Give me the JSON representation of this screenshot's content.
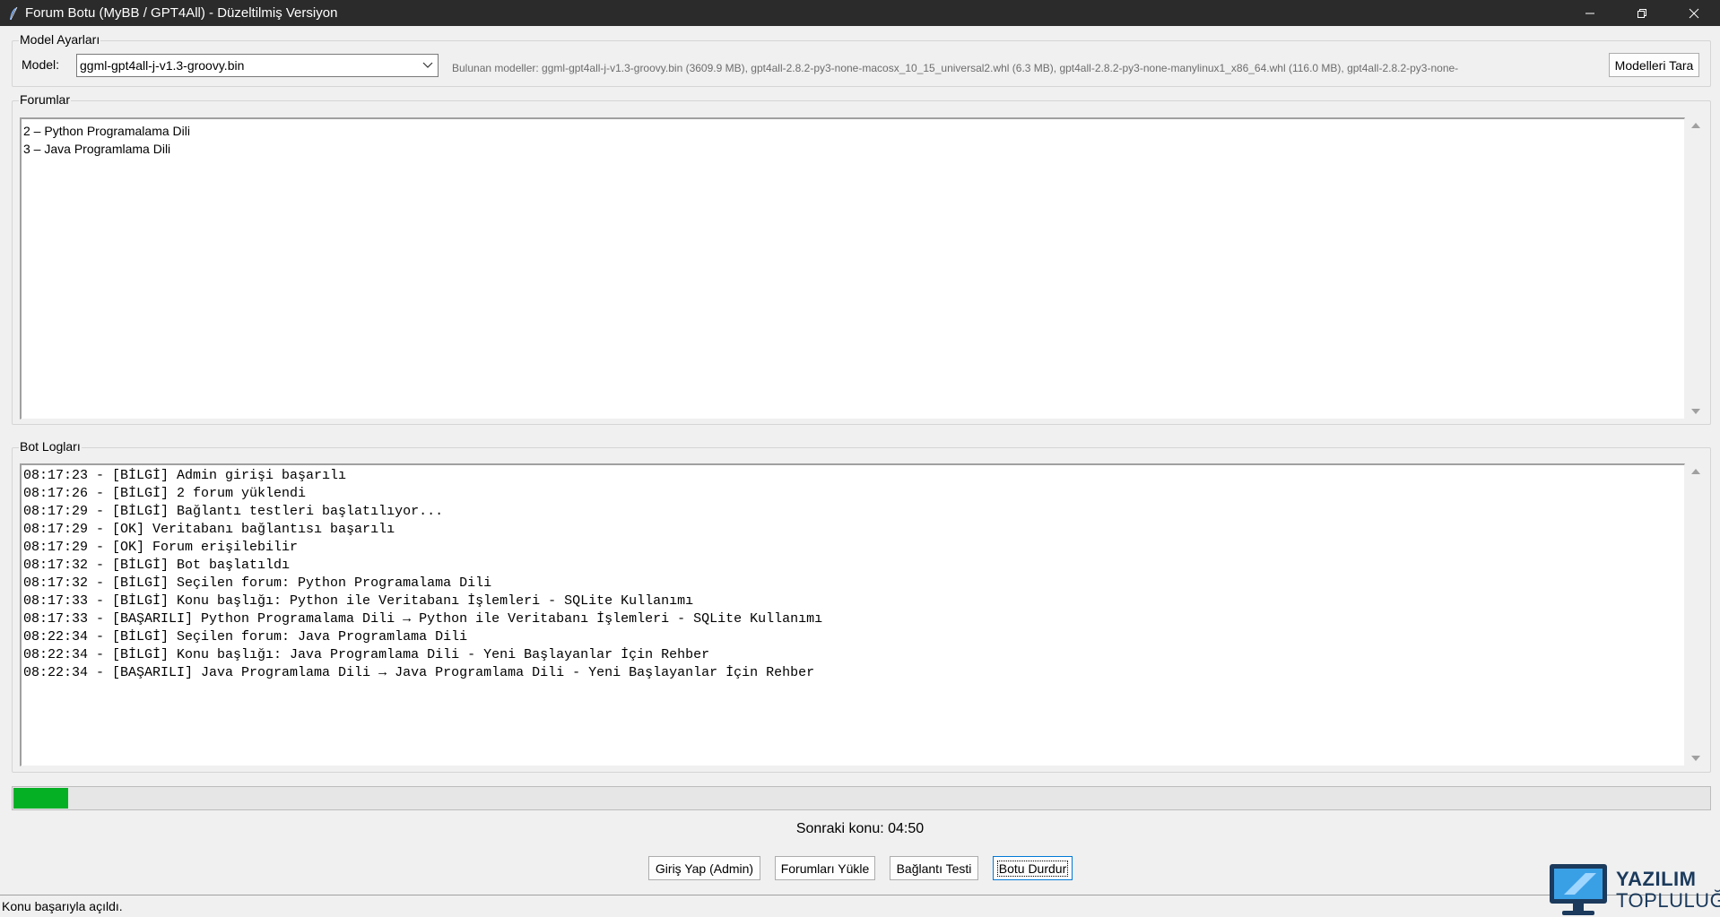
{
  "window": {
    "title": "Forum Botu (MyBB / GPT4All) - Düzeltilmiş Versiyon",
    "icon": "feather-icon"
  },
  "model_settings": {
    "group_label": "Model Ayarları",
    "model_label": "Model:",
    "selected_model": "ggml-gpt4all-j-v1.3-groovy.bin",
    "found_models_text": "Bulunan modeller: ggml-gpt4all-j-v1.3-groovy.bin (3609.9 MB), gpt4all-2.8.2-py3-none-macosx_10_15_universal2.whl (6.3 MB), gpt4all-2.8.2-py3-none-manylinux1_x86_64.whl (116.0 MB), gpt4all-2.8.2-py3-none-",
    "scan_button": "Modelleri Tara"
  },
  "forums": {
    "group_label": "Forumlar",
    "items": [
      "2 – Python Programalama Dili",
      "3 – Java Programlama Dili"
    ]
  },
  "logs": {
    "group_label": "Bot Logları",
    "lines": [
      "08:17:23 - [BİLGİ] Admin girişi başarılı",
      "08:17:26 - [BİLGİ] 2 forum yüklendi",
      "08:17:29 - [BİLGİ] Bağlantı testleri başlatılıyor...",
      "08:17:29 - [OK] Veritabanı bağlantısı başarılı",
      "08:17:29 - [OK] Forum erişilebilir",
      "08:17:32 - [BİLGİ] Bot başlatıldı",
      "08:17:32 - [BİLGİ] Seçilen forum: Python Programalama Dili",
      "08:17:33 - [BİLGİ] Konu başlığı: Python ile Veritabanı İşlemleri - SQLite Kullanımı",
      "08:17:33 - [BAŞARILI] Python Programalama Dili → Python ile Veritabanı İşlemleri - SQLite Kullanımı",
      "08:22:34 - [BİLGİ] Seçilen forum: Java Programlama Dili",
      "08:22:34 - [BİLGİ] Konu başlığı: Java Programlama Dili - Yeni Başlayanlar İçin Rehber",
      "08:22:34 - [BAŞARILI] Java Programlama Dili → Java Programlama Dili - Yeni Başlayanlar İçin Rehber"
    ]
  },
  "progress": {
    "fraction": 0.032,
    "color": "#06b025"
  },
  "next_topic_text": "Sonraki konu: 04:50",
  "actions": {
    "login": "Giriş Yap (Admin)",
    "load_forums": "Forumları Yükle",
    "connection_test": "Bağlantı Testi",
    "stop_bot": "Botu Durdur"
  },
  "status_bar": "Konu başarıyla açıldı.",
  "logo": {
    "line1": "YAZILIM",
    "line2": "TOPLULUĞU"
  }
}
